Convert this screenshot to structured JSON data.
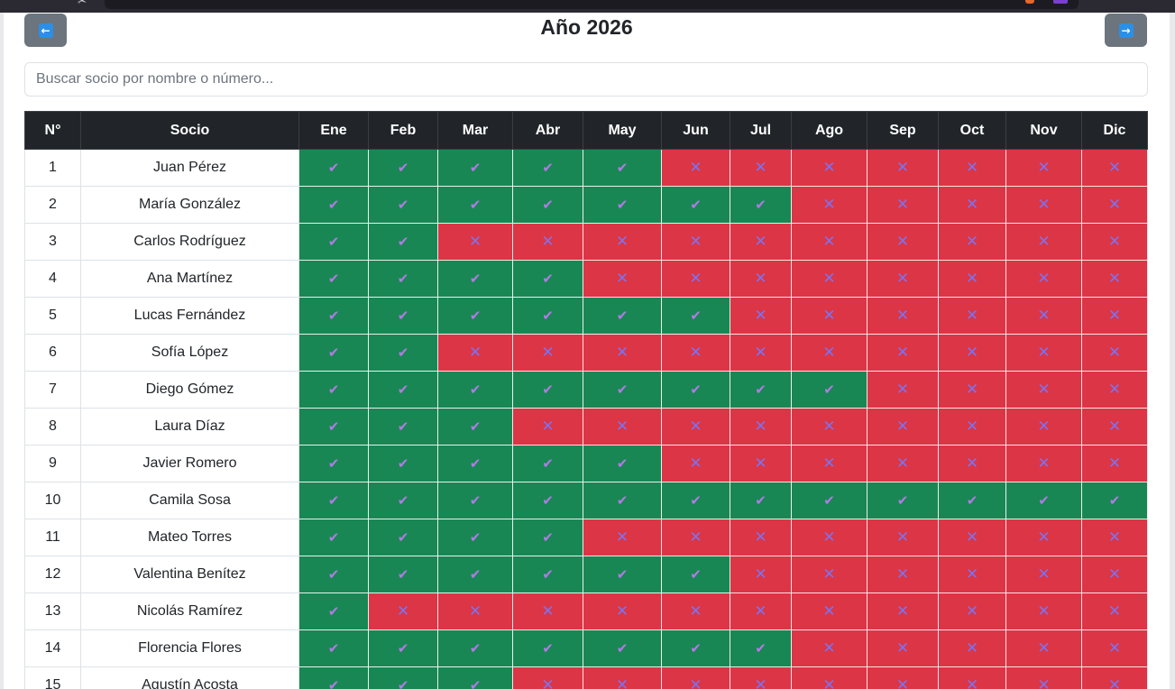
{
  "year_title": "Año 2026",
  "search": {
    "placeholder": "Buscar socio por nombre o número..."
  },
  "colors": {
    "paid": "#198754",
    "unpaid": "#dc3545",
    "header": "#212529",
    "nav_button": "#6c757d"
  },
  "icons": {
    "prev": "arrow-left-icon",
    "next": "arrow-right-icon",
    "paid": "check-icon",
    "unpaid": "cross-icon"
  },
  "table": {
    "headers": [
      "N°",
      "Socio",
      "Ene",
      "Feb",
      "Mar",
      "Abr",
      "May",
      "Jun",
      "Jul",
      "Ago",
      "Sep",
      "Oct",
      "Nov",
      "Dic"
    ],
    "rows": [
      {
        "num": "1",
        "name": "Juan Pérez",
        "paid_months": 5
      },
      {
        "num": "2",
        "name": "María González",
        "paid_months": 7
      },
      {
        "num": "3",
        "name": "Carlos Rodríguez",
        "paid_months": 2
      },
      {
        "num": "4",
        "name": "Ana Martínez",
        "paid_months": 4
      },
      {
        "num": "5",
        "name": "Lucas Fernández",
        "paid_months": 6
      },
      {
        "num": "6",
        "name": "Sofía López",
        "paid_months": 2
      },
      {
        "num": "7",
        "name": "Diego Gómez",
        "paid_months": 8
      },
      {
        "num": "8",
        "name": "Laura Díaz",
        "paid_months": 3
      },
      {
        "num": "9",
        "name": "Javier Romero",
        "paid_months": 5
      },
      {
        "num": "10",
        "name": "Camila Sosa",
        "paid_months": 12
      },
      {
        "num": "11",
        "name": "Mateo Torres",
        "paid_months": 4
      },
      {
        "num": "12",
        "name": "Valentina Benítez",
        "paid_months": 6
      },
      {
        "num": "13",
        "name": "Nicolás Ramírez",
        "paid_months": 1
      },
      {
        "num": "14",
        "name": "Florencia Flores",
        "paid_months": 7
      },
      {
        "num": "15",
        "name": "Agustín Acosta",
        "paid_months": 3
      }
    ]
  }
}
